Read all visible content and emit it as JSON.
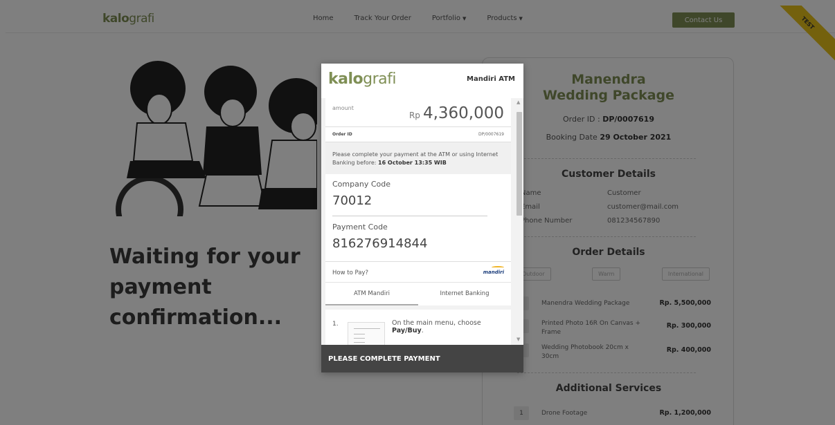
{
  "nav": {
    "logo_bold": "kalo",
    "logo_thin": "grafi",
    "links": [
      "Home",
      "Track Your Order",
      "Portfolio",
      "Products"
    ],
    "contact": "Contact Us",
    "ribbon": "TEST"
  },
  "hero": {
    "waiting_line1": "Waiting for your payment",
    "waiting_line2": "confirmation..."
  },
  "summary": {
    "title_line1": "Manendra",
    "title_line2": "Wedding Package",
    "order_prefix": "Order ID : ",
    "order_id": "DP/0007619",
    "booking_prefix": "Booking Date ",
    "booking_date": "29 October 2021",
    "customer_heading": "Customer Details",
    "customer_rows": [
      {
        "label": "Name",
        "value": "Customer"
      },
      {
        "label": "Email",
        "value": "customer@mail.com"
      },
      {
        "label": "Phone Number",
        "value": "081234567890"
      }
    ],
    "order_heading": "Order Details",
    "tags": [
      "Outdoor",
      "Warm",
      "International"
    ],
    "items": [
      {
        "qty": "",
        "name": "Manendra Wedding Package",
        "price": "Rp. 5,500,000"
      },
      {
        "qty": "",
        "name": "Printed Photo 16R On Canvas + Frame",
        "price": "Rp. 300,000"
      },
      {
        "qty": "",
        "name": "Wedding Photobook 20cm x 30cm",
        "price": "Rp. 400,000"
      }
    ],
    "additional_heading": "Additional Services",
    "additional": [
      {
        "qty": "1",
        "name": "Drone Footage",
        "price": "Rp. 1,200,000"
      }
    ]
  },
  "modal": {
    "logo_bold": "kalo",
    "logo_thin": "grafi",
    "method": "Mandiri ATM",
    "amount_label": "amount",
    "currency": "Rp",
    "amount": "4,360,000",
    "order_label": "Order ID",
    "order_id": "DP/0007619",
    "notice_text": "Please complete your payment at the ATM or using Internet Banking before: ",
    "notice_deadline": "16 October 13:35 WIB",
    "company_label": "Company Code",
    "company_code": "70012",
    "payment_label": "Payment Code",
    "payment_code": "816276914844",
    "howto": "How to Pay?",
    "bank_logo": "mandiri",
    "tabs": [
      "ATM Mandiri",
      "Internet Banking"
    ],
    "step_number": "1.",
    "step_text": "On the main menu, choose ",
    "step_bold": "Pay/Buy",
    "footer": "PLEASE COMPLETE PAYMENT"
  }
}
